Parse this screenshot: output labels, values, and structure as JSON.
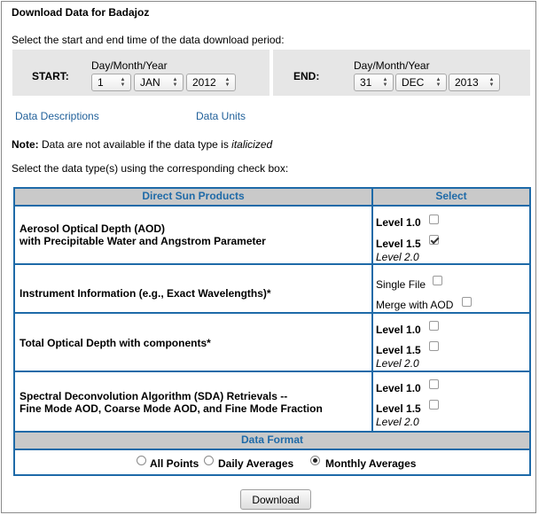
{
  "header": {
    "title": "Download Data for Badajoz",
    "period_instruction": "Select the start and end time of the data download period:"
  },
  "date_range": {
    "start_label": "START:",
    "end_label": "END:",
    "format_label": "Day/Month/Year",
    "start": {
      "day": "1",
      "month": "JAN",
      "year": "2012"
    },
    "end": {
      "day": "31",
      "month": "DEC",
      "year": "2013"
    }
  },
  "links": {
    "descriptions": "Data Descriptions",
    "units": "Data Units"
  },
  "note": {
    "label": "Note:",
    "text": "Data are not available if the data type is",
    "emphasis": "italicized"
  },
  "type_instruction": "Select the data type(s) using the corresponding check box:",
  "table": {
    "col_products": "Direct Sun Products",
    "col_select": "Select",
    "rows": [
      {
        "line1": "Aerosol Optical Depth (AOD)",
        "line2": "with Precipitable Water and Angstrom Parameter",
        "opt1": "Level 1.0",
        "opt1_checked": false,
        "opt2": "Level 1.5",
        "opt2_checked": true,
        "unavailable": "Level 2.0"
      },
      {
        "line1": "Instrument Information (e.g., Exact Wavelengths)*",
        "opt1": "Single File",
        "opt1_checked": false,
        "opt2": "Merge with AOD",
        "opt2_checked": false
      },
      {
        "line1": "Total Optical Depth with components*",
        "opt1": "Level 1.0",
        "opt1_checked": false,
        "opt2": "Level 1.5",
        "opt2_checked": false,
        "unavailable": "Level 2.0"
      },
      {
        "line1": "Spectral Deconvolution Algorithm (SDA) Retrievals --",
        "line2": "Fine Mode AOD, Coarse Mode AOD, and Fine Mode Fraction",
        "opt1": "Level 1.0",
        "opt1_checked": false,
        "opt2": "Level 1.5",
        "opt2_checked": false,
        "unavailable": "Level 2.0"
      }
    ],
    "format_header": "Data Format",
    "format_options": [
      {
        "label": "All Points",
        "selected": false
      },
      {
        "label": "Daily Averages",
        "selected": false
      },
      {
        "label": "Monthly Averages",
        "selected": true
      }
    ]
  },
  "download_button": "Download",
  "colors": {
    "table_border": "#1e6aa8",
    "header_bg": "#c9c9c9",
    "link": "#1f5f99",
    "date_panel_bg": "#e6e6e6"
  }
}
